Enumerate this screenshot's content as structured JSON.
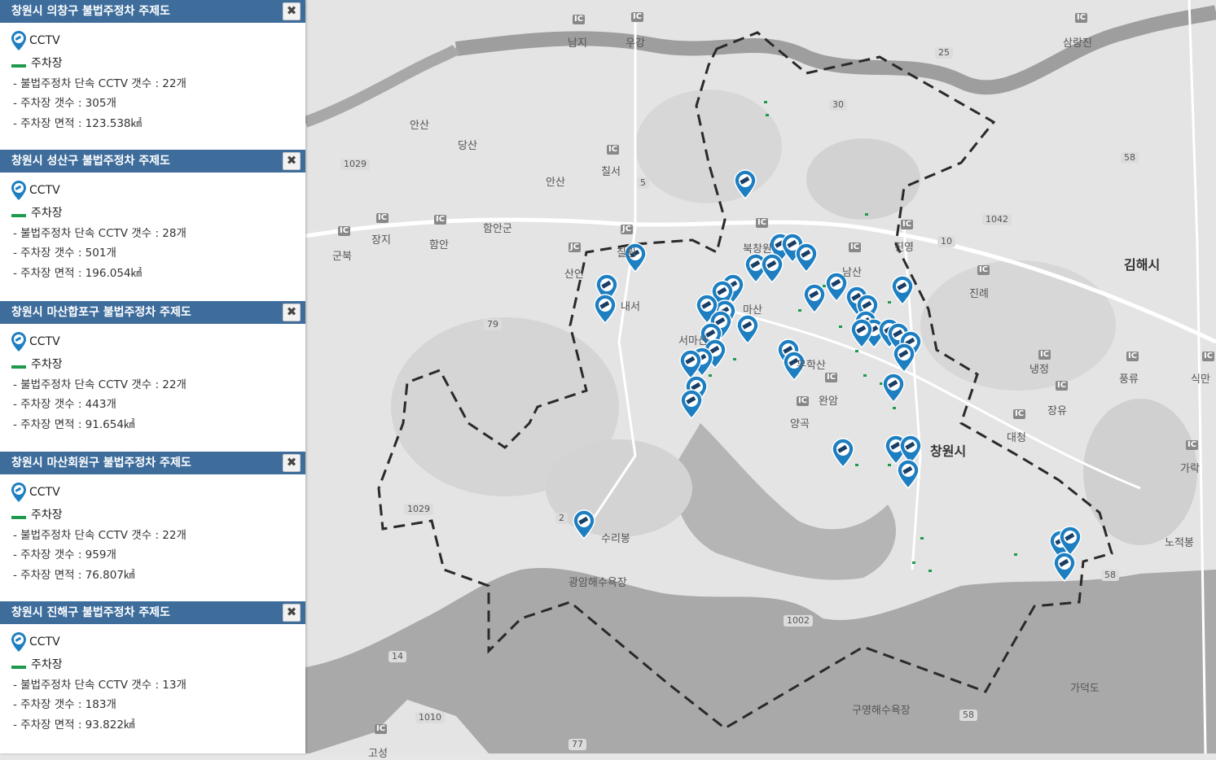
{
  "legends": [
    {
      "title": "창원시 의창구 불법주정차 주제도",
      "cctv_label": "CCTV",
      "lot_label": "주차장",
      "cctv_count": "- 불법주정차 단속 CCTV 갯수 : 22개",
      "lot_count": "- 주차장 갯수 : 305개",
      "lot_area": "- 주차장 면적 : 123.538㎢"
    },
    {
      "title": "창원시 성산구 불법주정차 주제도",
      "cctv_label": "CCTV",
      "lot_label": "주차장",
      "cctv_count": "- 불법주정차 단속 CCTV 갯수 : 28개",
      "lot_count": "- 주차장 갯수 : 501개",
      "lot_area": "- 주차장 면적 : 196.054㎢"
    },
    {
      "title": "창원시 마산합포구 불법주정차 주제도",
      "cctv_label": "CCTV",
      "lot_label": "주차장",
      "cctv_count": "- 불법주정차 단속 CCTV 갯수 : 22개",
      "lot_count": "- 주차장 갯수 : 443개",
      "lot_area": "- 주차장 면적 : 91.654㎢"
    },
    {
      "title": "창원시 마산회원구 불법주정차 주제도",
      "cctv_label": "CCTV",
      "lot_label": "주차장",
      "cctv_count": "- 불법주정차 단속 CCTV 갯수 : 22개",
      "lot_count": "- 주차장 갯수 : 959개",
      "lot_area": "- 주차장 면적 : 76.807㎢"
    },
    {
      "title": "창원시 진해구 불법주정차 주제도",
      "cctv_label": "CCTV",
      "lot_label": "주차장",
      "cctv_count": "- 불법주정차 단속 CCTV 갯수 : 13개",
      "lot_count": "- 주차장 갯수 : 183개",
      "lot_area": "- 주차장 면적 : 93.822㎢"
    }
  ],
  "close_glyph": "✖",
  "colors": {
    "header": "#3e6d9c",
    "marker": "#1d7fc1",
    "parking": "#1e9a4f"
  },
  "map": {
    "place_labels": [
      "남지",
      "우강",
      "삼랑진",
      "안산",
      "당산",
      "칠서",
      "안산",
      "장지",
      "함안군",
      "함안",
      "군북",
      "칠원",
      "산인",
      "북창원",
      "마산",
      "서마산",
      "진영",
      "남산",
      "진례",
      "내서",
      "무학산",
      "완암",
      "양곡",
      "창원시",
      "대청",
      "냉정",
      "장유",
      "풍류",
      "식만",
      "가락",
      "노적봉",
      "김해시",
      "수리봉",
      "광암해수욕장",
      "가덕도",
      "구영해수욕장",
      "고성"
    ],
    "road_numbers": [
      "25",
      "30",
      "5",
      "1029",
      "1029",
      "1042",
      "10",
      "58",
      "79",
      "2",
      "14",
      "1010",
      "1002",
      "58",
      "58",
      "77"
    ],
    "ic_badge": "IC",
    "jc_badge": "JC"
  }
}
